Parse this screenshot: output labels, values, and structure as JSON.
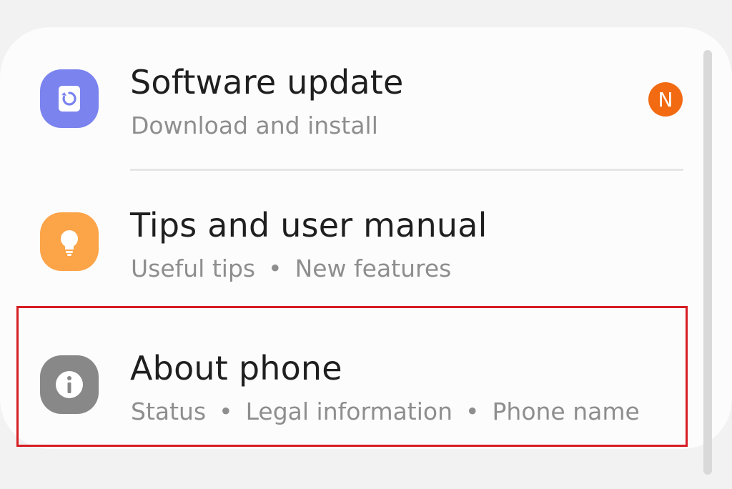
{
  "settings": {
    "items": [
      {
        "title": "Software update",
        "subtitle": "Download and install",
        "icon": "software-update-icon",
        "icon_color": "#7b83ef",
        "badge": "N",
        "badge_color": "#f26a12"
      },
      {
        "title": "Tips and user manual",
        "subtitle_parts": [
          "Useful tips",
          "New features"
        ],
        "icon": "lightbulb-icon",
        "icon_color": "#fca448"
      },
      {
        "title": "About phone",
        "subtitle_parts": [
          "Status",
          "Legal information",
          "Phone name"
        ],
        "icon": "info-icon",
        "icon_color": "#888888",
        "highlighted": true,
        "highlight_color": "#d61d24"
      }
    ]
  }
}
